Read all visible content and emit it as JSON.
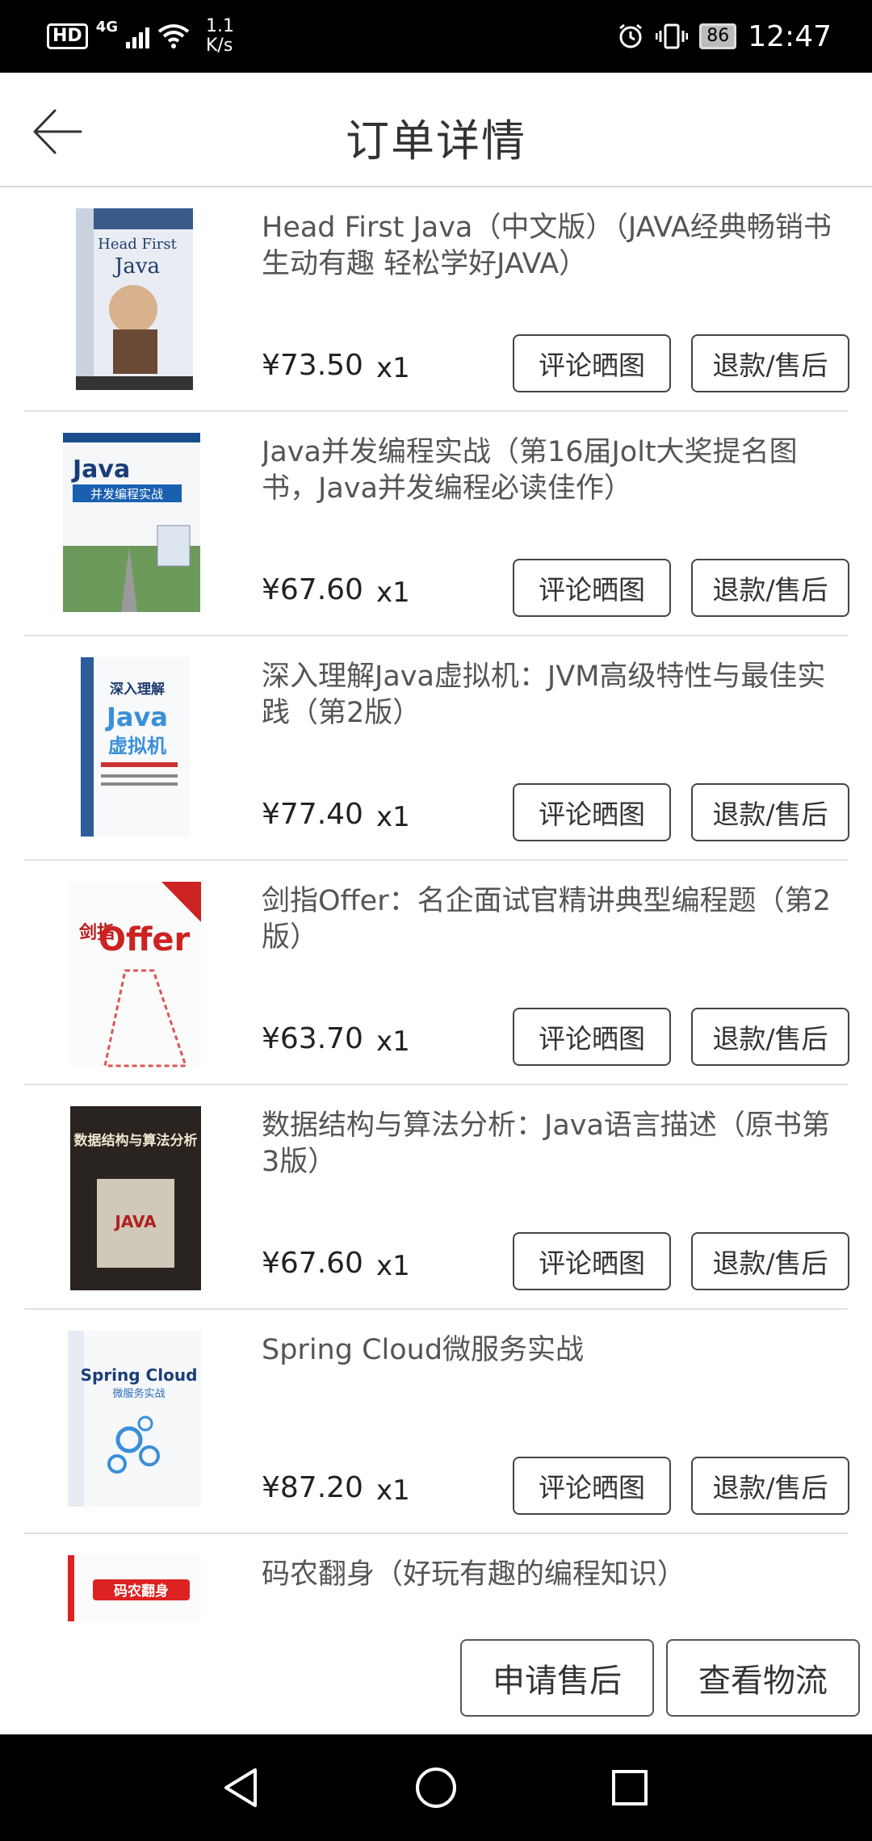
{
  "status_bar": {
    "hd": "HD",
    "network": "4G",
    "speed_value": "1.1",
    "speed_unit": "K/s",
    "battery": "86",
    "time": "12:47"
  },
  "header": {
    "title": "订单详情"
  },
  "orders": [
    {
      "title": "Head First Java（中文版）（JAVA经典畅销书 生动有趣 轻松学好JAVA）",
      "price": "¥73.50",
      "qty": "x1",
      "review_label": "评论晒图",
      "refund_label": "退款/售后"
    },
    {
      "title": "Java并发编程实战（第16届Jolt大奖提名图书，Java并发编程必读佳作）",
      "price": "¥67.60",
      "qty": "x1",
      "review_label": "评论晒图",
      "refund_label": "退款/售后"
    },
    {
      "title": "深入理解Java虚拟机：JVM高级特性与最佳实践（第2版）",
      "price": "¥77.40",
      "qty": "x1",
      "review_label": "评论晒图",
      "refund_label": "退款/售后"
    },
    {
      "title": "剑指Offer：名企面试官精讲典型编程题（第2版）",
      "price": "¥63.70",
      "qty": "x1",
      "review_label": "评论晒图",
      "refund_label": "退款/售后"
    },
    {
      "title": "数据结构与算法分析：Java语言描述（原书第3版）",
      "price": "¥67.60",
      "qty": "x1",
      "review_label": "评论晒图",
      "refund_label": "退款/售后"
    },
    {
      "title": "Spring Cloud微服务实战",
      "price": "¥87.20",
      "qty": "x1",
      "review_label": "评论晒图",
      "refund_label": "退款/售后"
    },
    {
      "title": "码农翻身（好玩有趣的编程知识）"
    }
  ],
  "covers": {
    "c1_line1": "Head First",
    "c1_line2": "Java",
    "c2_line1": "Java",
    "c2_line2": "并发编程实战",
    "c3_line1": "深入理解",
    "c3_line2": "Java",
    "c3_line3": "虚拟机",
    "c4_line1": "剑指",
    "c4_line2": "Offer",
    "c5_line1": "数据结构与算法分析",
    "c5_line2": "JAVA",
    "c6_line1": "Spring Cloud",
    "c6_line2": "微服务实战",
    "c7_line1": "码农翻身"
  },
  "footer": {
    "apply_label": "申请售后",
    "track_label": "查看物流"
  },
  "colors": {
    "status_bg": "#000000",
    "nav_bg": "#000000",
    "divider": "#e0e0e0"
  }
}
